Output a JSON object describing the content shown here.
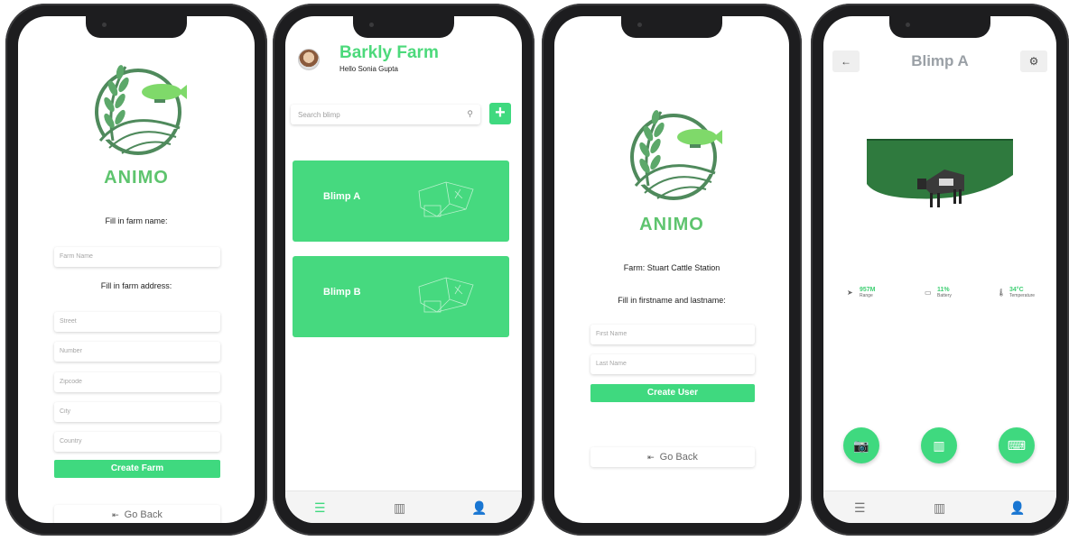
{
  "screen1": {
    "logo_text": "ANIMO",
    "label_farm_name": "Fill in farm name:",
    "placeholder_farm_name": "Farm Name",
    "label_farm_address": "Fill in farm address:",
    "placeholder_street": "Street",
    "placeholder_number": "Number",
    "placeholder_zipcode": "Zipcode",
    "placeholder_city": "City",
    "placeholder_country": "Country",
    "create_button": "Create Farm",
    "back_button": "Go Back"
  },
  "screen2": {
    "farm_title": "Barkly Farm",
    "greeting": "Hello Sonia Gupta",
    "search_placeholder": "Search blimp",
    "add_button": "+",
    "cards": [
      {
        "name": "Blimp A"
      },
      {
        "name": "Blimp B"
      }
    ],
    "tabs": [
      "list-icon",
      "map-icon",
      "user-icon"
    ]
  },
  "screen3": {
    "logo_text": "ANIMO",
    "farm_label": "Farm: Stuart Cattle Station",
    "name_label": "Fill in firstname and lastname:",
    "placeholder_first": "First Name",
    "placeholder_last": "Last Name",
    "create_button": "Create User",
    "back_button": "Go Back"
  },
  "screen4": {
    "title": "Blimp A",
    "stats": [
      {
        "value": "957M",
        "label": "Range",
        "icon": "navigation-icon"
      },
      {
        "value": "11%",
        "label": "Battery",
        "icon": "battery-icon"
      },
      {
        "value": "34°C",
        "label": "Temperature",
        "icon": "thermometer-icon"
      }
    ],
    "actions": [
      "camera-icon",
      "map-icon",
      "gamepad-icon"
    ],
    "tabs": [
      "list-icon",
      "map-icon",
      "user-icon"
    ]
  },
  "colors": {
    "accent": "#3fd97f",
    "logo": "#5ec46e",
    "phone_frame": "#1d1d1f"
  }
}
